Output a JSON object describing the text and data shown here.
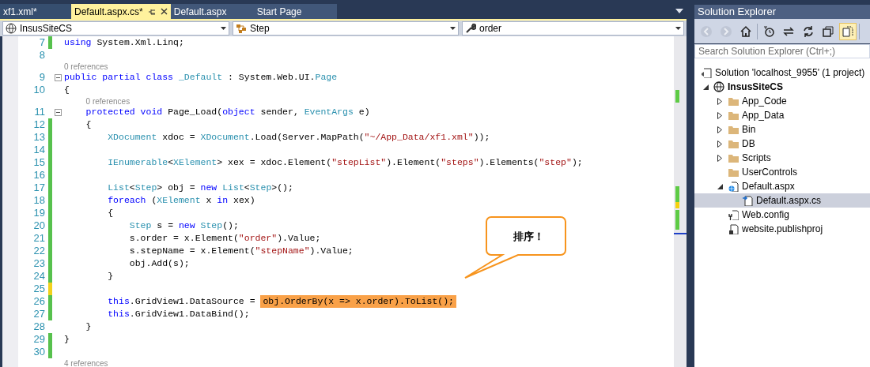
{
  "tabs": [
    {
      "label": "xf1.xml*",
      "selected": false
    },
    {
      "label": "Default.aspx.cs*",
      "selected": true
    },
    {
      "label": "Default.aspx",
      "selected": false
    },
    {
      "label": "Start Page",
      "selected": false
    }
  ],
  "nav_bar": {
    "project": "InsusSiteCS",
    "type": "Step",
    "member": "order"
  },
  "code_lines": [
    {
      "number": "7",
      "modified": true,
      "saved": true,
      "fold": false,
      "tokens": [
        {
          "kind": "keyword",
          "text": "using"
        },
        {
          "kind": "plain",
          "text": " System.Xml.Linq;"
        }
      ]
    },
    {
      "number": "8",
      "modified": false,
      "fold": false
    },
    {
      "number": "9",
      "modified": false,
      "references": "0 references",
      "fold": true,
      "tokens": [
        {
          "kind": "keyword",
          "text": "public partial class"
        },
        {
          "kind": "type",
          "text": " _Default"
        },
        {
          "kind": "plain",
          "text": " : System.Web.UI."
        },
        {
          "kind": "type",
          "text": "Page"
        }
      ]
    },
    {
      "number": "10",
      "modified": false,
      "fold": false,
      "tokens": [
        {
          "kind": "plain",
          "text": "{"
        }
      ]
    },
    {
      "number": "11",
      "modified": false,
      "references": "0 references",
      "fold": true,
      "tokens": [
        {
          "kind": "keyword",
          "text": "    protected void"
        },
        {
          "kind": "plain",
          "text": " Page_Load("
        },
        {
          "kind": "keyword",
          "text": "object"
        },
        {
          "kind": "plain",
          "text": " sender, "
        },
        {
          "kind": "type",
          "text": "EventArgs"
        },
        {
          "kind": "plain",
          "text": " e)"
        }
      ]
    },
    {
      "number": "12",
      "modified": true,
      "saved": true,
      "fold": false,
      "tokens": [
        {
          "kind": "plain",
          "text": "    {"
        }
      ]
    },
    {
      "number": "13",
      "modified": true,
      "saved": true,
      "fold": false,
      "tokens": [
        {
          "kind": "type",
          "text": "        XDocument"
        },
        {
          "kind": "plain",
          "text": " xdoc = "
        },
        {
          "kind": "type",
          "text": "XDocument"
        },
        {
          "kind": "plain",
          "text": ".Load(Server.MapPath("
        },
        {
          "kind": "string",
          "text": "\"~/App_Data/xf1.xml\""
        },
        {
          "kind": "plain",
          "text": "));"
        }
      ]
    },
    {
      "number": "14",
      "modified": true,
      "saved": true,
      "fold": false
    },
    {
      "number": "15",
      "modified": true,
      "saved": true,
      "fold": false,
      "tokens": [
        {
          "kind": "type",
          "text": "        IEnumerable"
        },
        {
          "kind": "plain",
          "text": "<"
        },
        {
          "kind": "type",
          "text": "XElement"
        },
        {
          "kind": "plain",
          "text": "> xex = xdoc.Element("
        },
        {
          "kind": "string",
          "text": "\"stepList\""
        },
        {
          "kind": "plain",
          "text": ").Element("
        },
        {
          "kind": "string",
          "text": "\"steps\""
        },
        {
          "kind": "plain",
          "text": ").Elements("
        },
        {
          "kind": "string",
          "text": "\"step\""
        },
        {
          "kind": "plain",
          "text": ");"
        }
      ]
    },
    {
      "number": "16",
      "modified": true,
      "saved": true,
      "fold": false
    },
    {
      "number": "17",
      "modified": true,
      "saved": true,
      "fold": false,
      "tokens": [
        {
          "kind": "type",
          "text": "        List"
        },
        {
          "kind": "plain",
          "text": "<"
        },
        {
          "kind": "type",
          "text": "Step"
        },
        {
          "kind": "plain",
          "text": "> obj = "
        },
        {
          "kind": "keyword",
          "text": "new"
        },
        {
          "kind": "type",
          "text": " List"
        },
        {
          "kind": "plain",
          "text": "<"
        },
        {
          "kind": "type",
          "text": "Step"
        },
        {
          "kind": "plain",
          "text": ">();"
        }
      ]
    },
    {
      "number": "18",
      "modified": true,
      "saved": true,
      "fold": false,
      "tokens": [
        {
          "kind": "keyword",
          "text": "        foreach"
        },
        {
          "kind": "plain",
          "text": " ("
        },
        {
          "kind": "type",
          "text": "XElement"
        },
        {
          "kind": "plain",
          "text": " x "
        },
        {
          "kind": "keyword",
          "text": "in"
        },
        {
          "kind": "plain",
          "text": " xex)"
        }
      ]
    },
    {
      "number": "19",
      "modified": true,
      "saved": true,
      "fold": false,
      "tokens": [
        {
          "kind": "plain",
          "text": "        {"
        }
      ]
    },
    {
      "number": "20",
      "modified": true,
      "saved": true,
      "fold": false,
      "tokens": [
        {
          "kind": "type",
          "text": "            Step"
        },
        {
          "kind": "plain",
          "text": " s = "
        },
        {
          "kind": "keyword",
          "text": "new"
        },
        {
          "kind": "type",
          "text": " Step"
        },
        {
          "kind": "plain",
          "text": "();"
        }
      ]
    },
    {
      "number": "21",
      "modified": true,
      "saved": true,
      "fold": false,
      "tokens": [
        {
          "kind": "plain",
          "text": "            s.order = x.Element("
        },
        {
          "kind": "string",
          "text": "\"order\""
        },
        {
          "kind": "plain",
          "text": ").Value;"
        }
      ]
    },
    {
      "number": "22",
      "modified": true,
      "saved": true,
      "fold": false,
      "tokens": [
        {
          "kind": "plain",
          "text": "            s.stepName = x.Element("
        },
        {
          "kind": "string",
          "text": "\"stepName\""
        },
        {
          "kind": "plain",
          "text": ").Value;"
        }
      ]
    },
    {
      "number": "23",
      "modified": true,
      "saved": true,
      "fold": false,
      "tokens": [
        {
          "kind": "plain",
          "text": "            obj.Add(s);"
        }
      ]
    },
    {
      "number": "24",
      "modified": true,
      "saved": true,
      "fold": false,
      "tokens": [
        {
          "kind": "plain",
          "text": "        }"
        }
      ]
    },
    {
      "number": "25",
      "modified": true,
      "saved": false,
      "fold": false
    },
    {
      "number": "26",
      "modified": true,
      "saved": true,
      "fold": false,
      "tokens": [
        {
          "kind": "keyword",
          "text": "        this"
        },
        {
          "kind": "plain",
          "text": ".GridView1.DataSource = "
        },
        {
          "kind": "highlight",
          "text": "obj.OrderBy(x => x.order).ToList();"
        }
      ]
    },
    {
      "number": "27",
      "modified": true,
      "saved": true,
      "fold": false,
      "tokens": [
        {
          "kind": "keyword",
          "text": "        this"
        },
        {
          "kind": "plain",
          "text": ".GridView1.DataBind();"
        }
      ]
    },
    {
      "number": "28",
      "modified": false,
      "fold": false,
      "tokens": [
        {
          "kind": "plain",
          "text": "    }"
        }
      ]
    },
    {
      "number": "29",
      "modified": true,
      "saved": true,
      "fold": false,
      "tokens": [
        {
          "kind": "plain",
          "text": "}"
        }
      ]
    },
    {
      "number": "30",
      "modified": true,
      "saved": true,
      "fold": false
    }
  ],
  "trailing_references": "4 references",
  "callout": {
    "text": "排序！"
  },
  "solution_explorer": {
    "title": "Solution Explorer",
    "toolbar": [
      {
        "kind": "back",
        "disabled": true
      },
      {
        "kind": "forward",
        "disabled": true
      },
      {
        "kind": "home",
        "disabled": false
      },
      {
        "kind": "pending",
        "disabled": false
      },
      {
        "kind": "sync",
        "disabled": false
      },
      {
        "kind": "refresh",
        "disabled": false
      },
      {
        "kind": "collapse",
        "disabled": false
      },
      {
        "kind": "show-files",
        "disabled": false,
        "on": true
      }
    ],
    "search": {
      "placeholder": "Search Solution Explorer (Ctrl+;)"
    },
    "tree": [
      {
        "kind": "solution",
        "label": "Solution 'localhost_9955' (1 project)",
        "selected": false,
        "children": [
          {
            "kind": "project",
            "label": "InsusSiteCS",
            "expanded": true,
            "selected": false,
            "children": [
              {
                "kind": "folder",
                "label": "App_Code",
                "expanded": false,
                "selected": false
              },
              {
                "kind": "folder",
                "label": "App_Data",
                "expanded": false,
                "selected": false
              },
              {
                "kind": "folder",
                "label": "Bin",
                "expanded": false,
                "selected": false
              },
              {
                "kind": "folder",
                "label": "DB",
                "expanded": false,
                "selected": false
              },
              {
                "kind": "folder",
                "label": "Scripts",
                "expanded": false,
                "selected": false
              },
              {
                "kind": "folder",
                "label": "UserControls",
                "selected": false
              },
              {
                "kind": "page",
                "label": "Default.aspx",
                "expanded": true,
                "selected": false,
                "children": [
                  {
                    "kind": "code",
                    "label": "Default.aspx.cs",
                    "selected": true
                  }
                ]
              },
              {
                "kind": "config",
                "label": "Web.config",
                "selected": false
              },
              {
                "kind": "publish",
                "label": "website.publishproj",
                "selected": false
              }
            ]
          }
        ]
      }
    ]
  }
}
